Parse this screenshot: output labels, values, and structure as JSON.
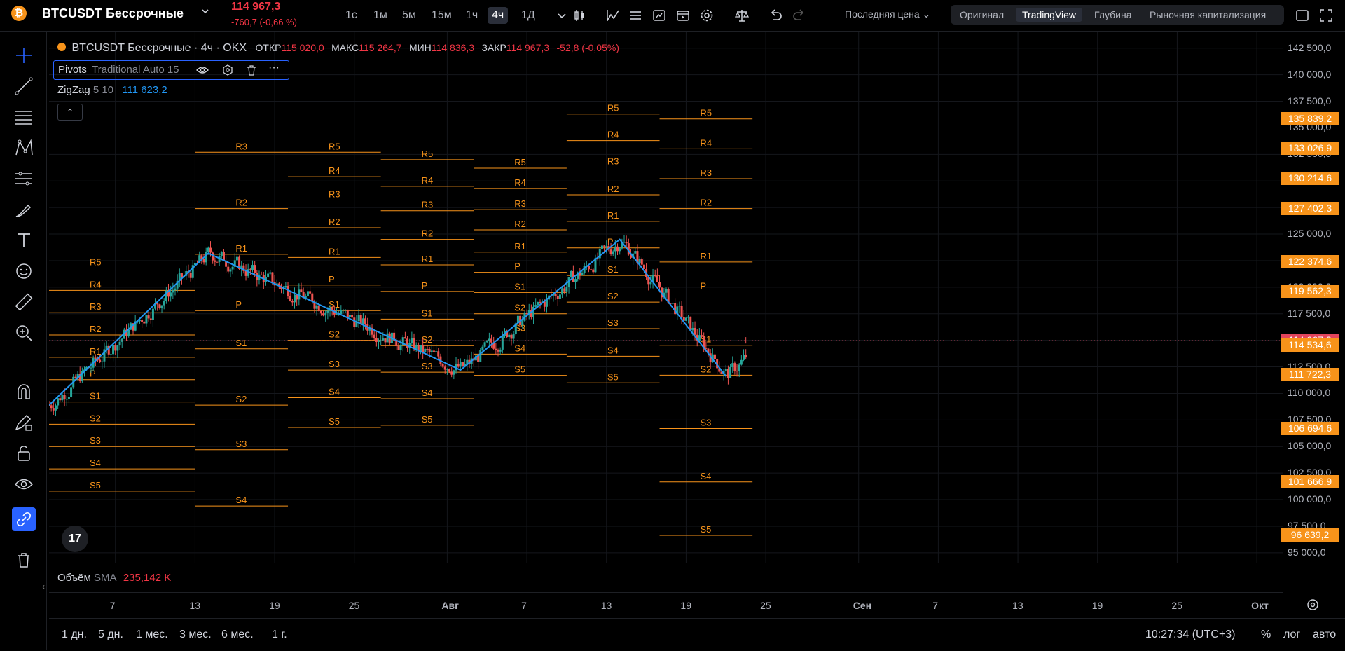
{
  "header": {
    "coin_glyph": "₿",
    "symbol": "BTCUSDT Бессрочные",
    "price": "114 967,3",
    "change": "-760,7 (-0,66 %)",
    "timeframes": [
      "1с",
      "1м",
      "5м",
      "15м",
      "1ч",
      "4ч",
      "1Д"
    ],
    "active_timeframe": "4ч",
    "price_type": "Последняя цена",
    "views": [
      "Оригинал",
      "TradingView",
      "Глубина",
      "Рыночная капитализация"
    ],
    "active_view": "TradingView"
  },
  "legend": {
    "title": "BTCUSDT Бессрочные · 4ч · OKX",
    "open_label": "ОТКР",
    "open": "115 020,0",
    "high_label": "МАКС",
    "high": "115 264,7",
    "low_label": "МИН",
    "low": "114 836,3",
    "close_label": "ЗАКР",
    "close": "114 967,3",
    "change": "-52,8 (-0,05%)"
  },
  "pivots": {
    "name": "Pivots",
    "params": "Traditional Auto 15"
  },
  "zigzag": {
    "name": "ZigZag",
    "params": "5 10",
    "value": "111 623,2"
  },
  "volume": {
    "name": "Объём",
    "ma": "SMA",
    "value": "235,142 K"
  },
  "price_axis": {
    "labels": [
      "142 500,0",
      "140 000,0",
      "137 500,0",
      "135 000,0",
      "132 500,0",
      "130 000,0",
      "127 500,0",
      "125 000,0",
      "122 500,0",
      "120 000,0",
      "117 500,0",
      "115 000,0",
      "112 500,0",
      "110 000,0",
      "107 500,0",
      "105 000,0",
      "102 500,0",
      "100 000,0",
      "97 500,0",
      "95 000,0"
    ],
    "tags": [
      {
        "text": "135 839,2",
        "color": "#f7931a"
      },
      {
        "text": "133 026,9",
        "color": "#f7931a"
      },
      {
        "text": "130 214,6",
        "color": "#f7931a"
      },
      {
        "text": "127 402,3",
        "color": "#f7931a"
      },
      {
        "text": "122 374,6",
        "color": "#f7931a"
      },
      {
        "text": "119 562,3",
        "color": "#f7931a"
      },
      {
        "text": "114 967,3",
        "color": "#e2445c"
      },
      {
        "text": "114 534,6",
        "color": "#f7931a"
      },
      {
        "text": "111 722,3",
        "color": "#f7931a"
      },
      {
        "text": "106 694,6",
        "color": "#f7931a"
      },
      {
        "text": "101 666,9",
        "color": "#f7931a"
      },
      {
        "text": "96 639,2",
        "color": "#f7931a"
      }
    ]
  },
  "time_axis": [
    "7",
    "13",
    "19",
    "25",
    "Авг",
    "7",
    "13",
    "19",
    "25",
    "Сен",
    "7",
    "13",
    "19",
    "25",
    "Окт"
  ],
  "ranges": [
    "1 дн.",
    "5 дн.",
    "1 мес.",
    "3 мес.",
    "6 мес.",
    "1 г."
  ],
  "clock": "10:27:34 (UTC+3)",
  "scale_options": [
    "%",
    "лог",
    "авто"
  ],
  "colors": {
    "pivot": "#f7931a",
    "zigzag": "#2196f3",
    "up": "#26a69a",
    "down": "#ef5350",
    "price": "#e2445c"
  },
  "chart_data": {
    "type": "candlestick",
    "instrument": "BTCUSDT",
    "interval": "4ч",
    "y_range": [
      94000,
      144000
    ],
    "x_range": [
      "2025-07-02",
      "2025-10-03"
    ],
    "x_ticks": [
      "7",
      "13",
      "19",
      "25",
      "Авг",
      "7",
      "13",
      "19",
      "25",
      "Сен",
      "7",
      "13",
      "19",
      "25",
      "Окт"
    ],
    "current_price": 114967.3,
    "zigzag_points": [
      {
        "x": "2025-07-02",
        "y": 108900
      },
      {
        "x": "2025-07-14",
        "y": 123200
      },
      {
        "x": "2025-08-02",
        "y": 112200
      },
      {
        "x": "2025-08-14",
        "y": 124500
      },
      {
        "x": "2025-08-22",
        "y": 111623.2
      }
    ],
    "pivot_periods": [
      {
        "start": "2025-07-02",
        "end": "2025-07-13",
        "levels": {
          "R5": 121800,
          "R4": 119700,
          "R3": 117600,
          "R2": 115500,
          "R1": 113400,
          "P": 111300,
          "S1": 109200,
          "S2": 107100,
          "S3": 105000,
          "S4": 102900,
          "S5": 100800
        }
      },
      {
        "start": "2025-07-13",
        "end": "2025-07-20",
        "levels": {
          "R3": 132700,
          "R2": 127400,
          "R1": 123100,
          "P": 117800,
          "S1": 114200,
          "S2": 108900,
          "S3": 104700,
          "S4": 99400
        }
      },
      {
        "start": "2025-07-20",
        "end": "2025-07-27",
        "levels": {
          "R5": 132700,
          "R4": 130400,
          "R3": 128200,
          "R2": 125600,
          "R1": 122800,
          "P": 120200,
          "S1": 117800,
          "S2": 115000,
          "S3": 112200,
          "S4": 109600,
          "S5": 106800
        }
      },
      {
        "start": "2025-07-27",
        "end": "2025-08-03",
        "levels": {
          "R5": 132000,
          "R4": 129500,
          "R3": 127200,
          "R2": 124500,
          "R1": 122100,
          "P": 119600,
          "S1": 117000,
          "S2": 114500,
          "S3": 112000,
          "S4": 109500,
          "S5": 107000
        }
      },
      {
        "start": "2025-08-03",
        "end": "2025-08-10",
        "levels": {
          "R5": 131200,
          "R4": 129300,
          "R3": 127300,
          "R2": 125400,
          "R1": 123300,
          "P": 121400,
          "S1": 119500,
          "S2": 117500,
          "S3": 115600,
          "S4": 113700,
          "S5": 111700
        }
      },
      {
        "start": "2025-08-10",
        "end": "2025-08-17",
        "levels": {
          "R5": 136300,
          "R4": 133800,
          "R3": 131300,
          "R2": 128700,
          "R1": 126200,
          "P": 123700,
          "S1": 121100,
          "S2": 118600,
          "S3": 116100,
          "S4": 113500,
          "S5": 111000
        }
      },
      {
        "start": "2025-08-17",
        "end": "2025-08-24",
        "levels": {
          "R5": 135839.2,
          "R4": 133026.9,
          "R3": 130214.6,
          "R2": 127402.3,
          "R1": 122374.6,
          "P": 119562.3,
          "S1": 114534.6,
          "S2": 111722.3,
          "S3": 106694.6,
          "S4": 101666.9,
          "S5": 96639.2
        }
      }
    ]
  }
}
